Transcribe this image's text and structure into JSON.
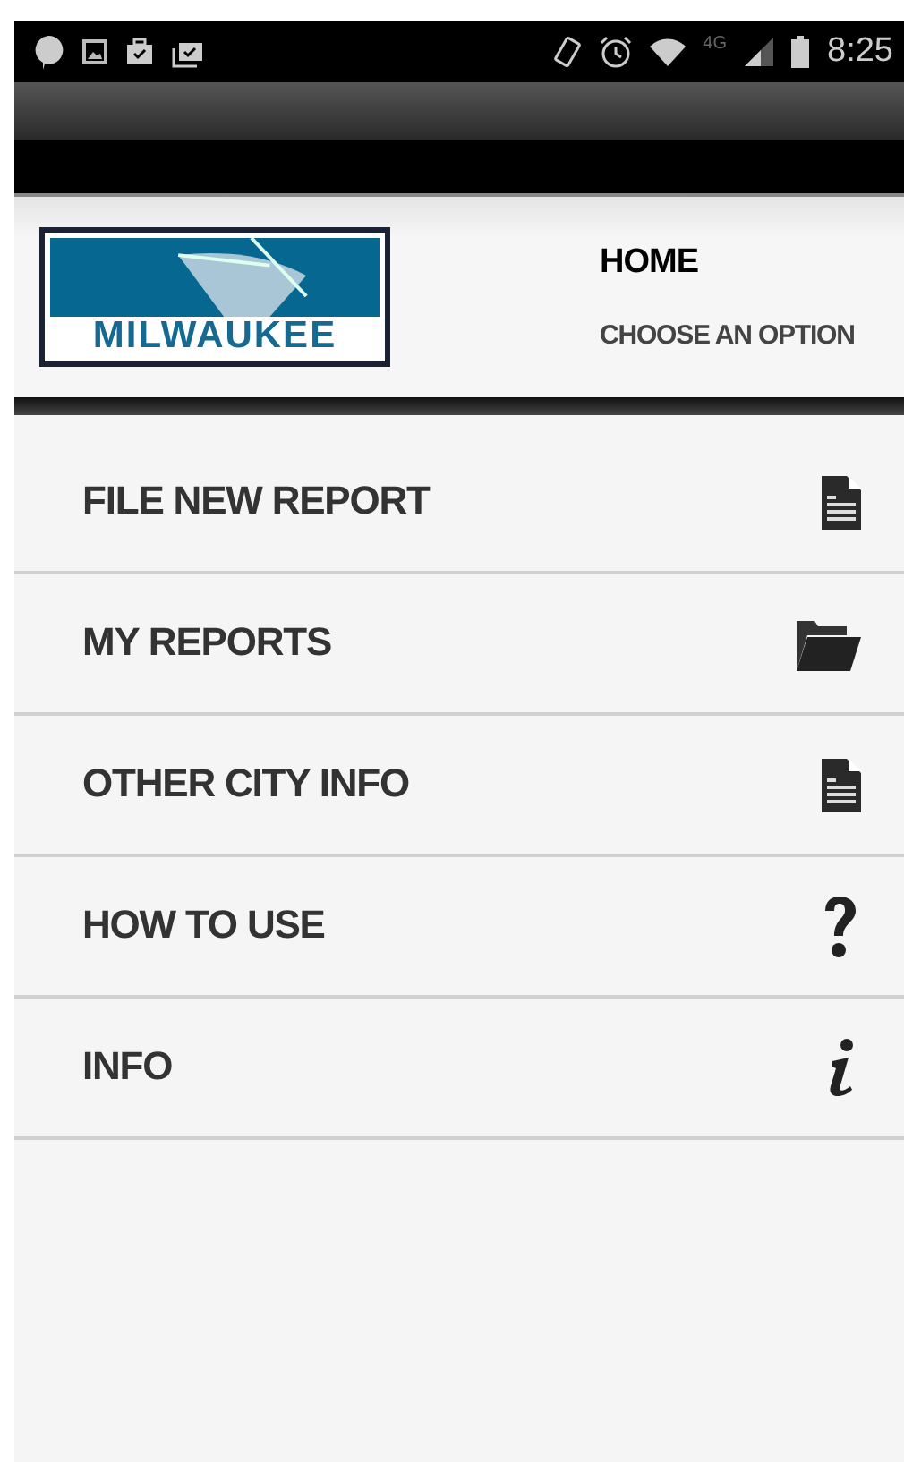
{
  "status_bar": {
    "network": "4G",
    "time": "8:25"
  },
  "header": {
    "logo_text": "MILWAUKEE",
    "title": "HOME",
    "subtitle": "CHOOSE AN OPTION"
  },
  "menu": [
    {
      "label": "FILE NEW REPORT",
      "kind": "document"
    },
    {
      "label": "MY REPORTS",
      "kind": "folder"
    },
    {
      "label": "OTHER CITY INFO",
      "kind": "document"
    },
    {
      "label": "HOW TO USE",
      "kind": "help"
    },
    {
      "label": "INFO",
      "kind": "info"
    }
  ]
}
